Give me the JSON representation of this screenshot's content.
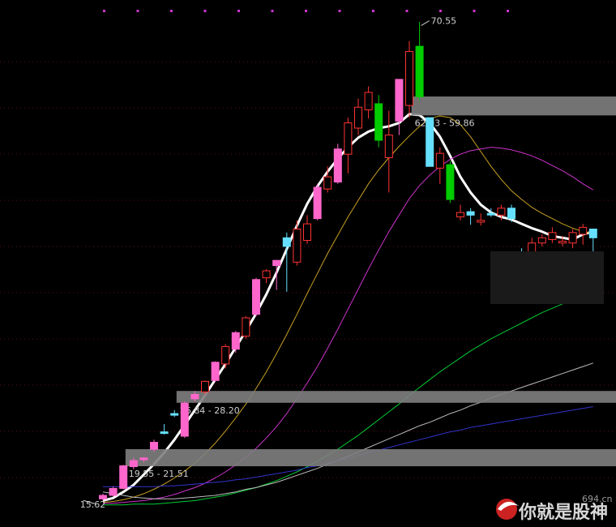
{
  "chart_data": {
    "type": "candlestick",
    "ylim": [
      13.5,
      72.0
    ],
    "candles": [
      {
        "o": 15.8,
        "h": 16.4,
        "l": 15.6,
        "c": 16.2,
        "color": "#ff66cc",
        "filled": true
      },
      {
        "o": 16.2,
        "h": 17.2,
        "l": 16.1,
        "c": 17.0,
        "color": "#ff66cc",
        "filled": true
      },
      {
        "o": 17.0,
        "h": 19.7,
        "l": 16.9,
        "c": 19.6,
        "color": "#ff66cc",
        "filled": true
      },
      {
        "o": 19.5,
        "h": 20.5,
        "l": 19.2,
        "c": 20.2,
        "color": "#ff66cc",
        "filled": true
      },
      {
        "o": 20.3,
        "h": 20.6,
        "l": 20.0,
        "c": 20.5,
        "color": "#ff66cc",
        "filled": true
      },
      {
        "o": 21.5,
        "h": 22.6,
        "l": 21.2,
        "c": 22.3,
        "color": "#ff66cc",
        "filled": true
      },
      {
        "o": 23.5,
        "h": 24.4,
        "l": 23.2,
        "c": 23.4,
        "color": "#66e0ff",
        "filled": true
      },
      {
        "o": 25.6,
        "h": 26.0,
        "l": 25.2,
        "c": 25.6,
        "color": "#66e0ff",
        "filled": true
      },
      {
        "o": 23.0,
        "h": 27.0,
        "l": 22.8,
        "c": 26.8,
        "color": "#ff66cc",
        "filled": true
      },
      {
        "o": 27.3,
        "h": 28.2,
        "l": 27.0,
        "c": 27.8,
        "color": "#ff66cc",
        "filled": true
      },
      {
        "o": 28.1,
        "h": 29.4,
        "l": 27.8,
        "c": 29.3,
        "color": "#ff3333",
        "filled": false
      },
      {
        "o": 29.4,
        "h": 31.6,
        "l": 29.2,
        "c": 31.5,
        "color": "#ff66cc",
        "filled": true
      },
      {
        "o": 31.3,
        "h": 33.6,
        "l": 30.8,
        "c": 33.3,
        "color": "#ff3333",
        "filled": false
      },
      {
        "o": 33.0,
        "h": 35.1,
        "l": 32.6,
        "c": 34.9,
        "color": "#ff66cc",
        "filled": true
      },
      {
        "o": 34.5,
        "h": 36.8,
        "l": 34.2,
        "c": 36.6,
        "color": "#ff3333",
        "filled": false
      },
      {
        "o": 37.0,
        "h": 41.2,
        "l": 36.8,
        "c": 41.0,
        "color": "#ff66cc",
        "filled": true
      },
      {
        "o": 41.2,
        "h": 42.2,
        "l": 40.6,
        "c": 42.0,
        "color": "#ff3333",
        "filled": false
      },
      {
        "o": 42.6,
        "h": 43.2,
        "l": 39.8,
        "c": 43.2,
        "color": "#ff66cc",
        "filled": true
      },
      {
        "o": 45.8,
        "h": 46.4,
        "l": 39.6,
        "c": 44.8,
        "color": "#66e0ff",
        "filled": true
      },
      {
        "o": 43.0,
        "h": 47.8,
        "l": 42.6,
        "c": 46.8,
        "color": "#ff3333",
        "filled": false
      },
      {
        "o": 45.5,
        "h": 48.4,
        "l": 45.1,
        "c": 47.4,
        "color": "#ff3333",
        "filled": false
      },
      {
        "o": 48.0,
        "h": 52.0,
        "l": 47.8,
        "c": 51.6,
        "color": "#ff66cc",
        "filled": true
      },
      {
        "o": 51.4,
        "h": 54.0,
        "l": 51.0,
        "c": 52.8,
        "color": "#ff3333",
        "filled": false
      },
      {
        "o": 52.2,
        "h": 56.6,
        "l": 52.0,
        "c": 56.0,
        "color": "#ff66cc",
        "filled": true
      },
      {
        "o": 55.4,
        "h": 59.6,
        "l": 53.2,
        "c": 59.0,
        "color": "#ff3333",
        "filled": false
      },
      {
        "o": 58.4,
        "h": 61.8,
        "l": 57.6,
        "c": 60.8,
        "color": "#ff3333",
        "filled": false
      },
      {
        "o": 60.5,
        "h": 63.2,
        "l": 59.5,
        "c": 62.5,
        "color": "#ff3333",
        "filled": false
      },
      {
        "o": 61.2,
        "h": 62.2,
        "l": 56.2,
        "c": 57.0,
        "color": "#00cc00",
        "filled": true
      },
      {
        "o": 55.0,
        "h": 60.4,
        "l": 51.0,
        "c": 57.6,
        "color": "#ff3333",
        "filled": false
      },
      {
        "o": 59.2,
        "h": 64.0,
        "l": 57.6,
        "c": 64.0,
        "color": "#ff66cc",
        "filled": true
      },
      {
        "o": 61.0,
        "h": 68.4,
        "l": 59.6,
        "c": 67.2,
        "color": "#ff3333",
        "filled": false
      },
      {
        "o": 67.8,
        "h": 70.6,
        "l": 61.6,
        "c": 62.0,
        "color": "#00cc00",
        "filled": true
      },
      {
        "o": 59.6,
        "h": 57.8,
        "l": 54.0,
        "c": 54.0,
        "color": "#66e0ff",
        "filled": true
      },
      {
        "o": 55.5,
        "h": 56.2,
        "l": 52.0,
        "c": 53.8,
        "color": "#ff3333",
        "filled": false
      },
      {
        "o": 54.2,
        "h": 54.6,
        "l": 49.8,
        "c": 50.2,
        "color": "#00cc00",
        "filled": true
      },
      {
        "o": 48.7,
        "h": 49.6,
        "l": 47.8,
        "c": 48.2,
        "color": "#ff3333",
        "filled": false
      },
      {
        "o": 48.8,
        "h": 49.2,
        "l": 47.3,
        "c": 48.4,
        "color": "#66e0ff",
        "filled": true
      },
      {
        "o": 47.6,
        "h": 48.6,
        "l": 47.2,
        "c": 47.8,
        "color": "#ff3333",
        "filled": false
      },
      {
        "o": 48.6,
        "h": 49.2,
        "l": 48.2,
        "c": 48.5,
        "color": "#66e0ff",
        "filled": true
      },
      {
        "o": 48.4,
        "h": 49.6,
        "l": 47.8,
        "c": 49.2,
        "color": "#ff3333",
        "filled": false
      },
      {
        "o": 49.2,
        "h": 49.6,
        "l": 47.6,
        "c": 48.0,
        "color": "#66e0ff",
        "filled": true
      },
      {
        "o": 44.0,
        "h": 44.6,
        "l": 42.6,
        "c": 43.6,
        "color": "#66e0ff",
        "filled": true
      },
      {
        "o": 43.4,
        "h": 45.8,
        "l": 43.0,
        "c": 45.2,
        "color": "#ff3333",
        "filled": false
      },
      {
        "o": 45.2,
        "h": 46.2,
        "l": 44.8,
        "c": 45.8,
        "color": "#ff3333",
        "filled": false
      },
      {
        "o": 45.6,
        "h": 47.0,
        "l": 45.2,
        "c": 46.4,
        "color": "#ff3333",
        "filled": false
      },
      {
        "o": 45.4,
        "h": 46.0,
        "l": 44.8,
        "c": 45.2,
        "color": "#ff3333",
        "filled": false
      },
      {
        "o": 45.2,
        "h": 46.8,
        "l": 44.6,
        "c": 46.4,
        "color": "#ff3333",
        "filled": false
      },
      {
        "o": 46.2,
        "h": 47.4,
        "l": 45.0,
        "c": 47.0,
        "color": "#ff3333",
        "filled": false
      },
      {
        "o": 46.8,
        "h": 46.8,
        "l": 42.6,
        "c": 45.8,
        "color": "#66e0ff",
        "filled": true
      }
    ],
    "moving_averages": [
      {
        "color": "#ffffff",
        "values": [
          15.6,
          15.9,
          16.6,
          17.4,
          18.6,
          19.8,
          21.1,
          22.6,
          24.3,
          26.0,
          27.7,
          29.5,
          31.3,
          33.2,
          35.1,
          37.1,
          39.3,
          41.8,
          44.5,
          47.2,
          49.7,
          51.7,
          53.4,
          54.9,
          56.2,
          57.3,
          58.0,
          58.4,
          58.6,
          59.0,
          60.0,
          59.9,
          59.0,
          57.4,
          55.2,
          52.8,
          51.0,
          49.6,
          48.7,
          48.2,
          47.9,
          47.4,
          46.9,
          46.5,
          46.0,
          45.8,
          45.6,
          46.2,
          46.5
        ]
      },
      {
        "color": "#c8a020",
        "values": [
          15.4,
          15.5,
          15.7,
          16.0,
          16.4,
          16.9,
          17.5,
          18.2,
          19.0,
          19.9,
          21.0,
          22.2,
          23.6,
          25.1,
          26.7,
          28.5,
          30.4,
          32.5,
          34.7,
          37.0,
          39.4,
          41.7,
          44.0,
          46.1,
          48.2,
          50.1,
          52.0,
          53.6,
          55.0,
          56.3,
          57.5,
          58.6,
          59.5,
          59.8,
          59.6,
          58.8,
          57.4,
          55.7,
          54.0,
          52.5,
          51.2,
          50.2,
          49.3,
          48.6,
          48.0,
          47.4,
          46.9,
          46.5,
          46.3
        ]
      },
      {
        "color": "#cc33cc",
        "values": [
          15.3,
          15.3,
          15.4,
          15.5,
          15.6,
          15.8,
          16.0,
          16.3,
          16.7,
          17.1,
          17.6,
          18.2,
          18.9,
          19.7,
          20.6,
          21.6,
          22.8,
          24.1,
          25.6,
          27.3,
          29.1,
          31.0,
          33.1,
          35.3,
          37.6,
          39.9,
          42.2,
          44.4,
          46.5,
          48.4,
          50.3,
          51.8,
          53.0,
          54.0,
          54.8,
          55.4,
          55.8,
          56.0,
          56.2,
          56.1,
          55.9,
          55.6,
          55.2,
          54.7,
          54.1,
          53.5,
          52.8,
          52.0,
          51.3
        ]
      },
      {
        "color": "#00cc33",
        "values": [
          15.1,
          15.1,
          15.1,
          15.2,
          15.2,
          15.2,
          15.3,
          15.4,
          15.5,
          15.6,
          15.8,
          16.0,
          16.2,
          16.5,
          16.8,
          17.1,
          17.5,
          17.9,
          18.4,
          18.9,
          19.5,
          20.1,
          20.8,
          21.5,
          22.3,
          23.1,
          24.0,
          24.9,
          25.8,
          26.7,
          27.7,
          28.6,
          29.5,
          30.4,
          31.2,
          32.0,
          32.8,
          33.5,
          34.2,
          34.8,
          35.4,
          36.0,
          36.6,
          37.2,
          37.7,
          38.2,
          38.7,
          39.2,
          39.7
        ]
      },
      {
        "color": "#bbbbbb",
        "values": [
          16.6,
          16.4,
          16.2,
          16.0,
          15.9,
          15.8,
          15.8,
          15.8,
          15.9,
          16.0,
          16.1,
          16.2,
          16.4,
          16.6,
          16.9,
          17.1,
          17.4,
          17.7,
          18.1,
          18.5,
          18.9,
          19.3,
          19.8,
          20.2,
          20.7,
          21.2,
          21.7,
          22.2,
          22.7,
          23.2,
          23.7,
          24.2,
          24.6,
          25.1,
          25.6,
          26.0,
          26.5,
          26.9,
          27.4,
          27.8,
          28.2,
          28.6,
          29.0,
          29.4,
          29.8,
          30.2,
          30.6,
          31.0,
          31.4
        ]
      },
      {
        "color": "#3333cc",
        "values": [
          17.2,
          17.2,
          17.2,
          17.2,
          17.2,
          17.2,
          17.3,
          17.3,
          17.4,
          17.5,
          17.6,
          17.7,
          17.8,
          18.0,
          18.1,
          18.3,
          18.5,
          18.7,
          18.9,
          19.1,
          19.4,
          19.6,
          19.9,
          20.2,
          20.5,
          20.8,
          21.1,
          21.4,
          21.7,
          22.0,
          22.3,
          22.6,
          22.9,
          23.2,
          23.5,
          23.7,
          24.0,
          24.2,
          24.4,
          24.6,
          24.8,
          25.0,
          25.2,
          25.4,
          25.6,
          25.8,
          26.0,
          26.2,
          26.4
        ]
      }
    ],
    "price_bands": [
      {
        "label": "62.03 - 59.86",
        "y_top": 62.03,
        "y_bottom": 59.86,
        "start_index": 31
      },
      {
        "label": "26.84 - 28.20",
        "y_top": 28.2,
        "y_bottom": 26.84,
        "start_index": 8
      },
      {
        "label": "19.55 - 21.51",
        "y_top": 21.51,
        "y_bottom": 19.55,
        "start_index": 3
      }
    ],
    "annotations": [
      {
        "text": "70.55",
        "value": 70.55,
        "index": 31,
        "kind": "high"
      },
      {
        "text": "15.62",
        "value": 15.62,
        "index": 3,
        "kind": "low"
      }
    ]
  },
  "watermark": {
    "brand_text": "你就是股神",
    "site_text": "694.cn"
  }
}
